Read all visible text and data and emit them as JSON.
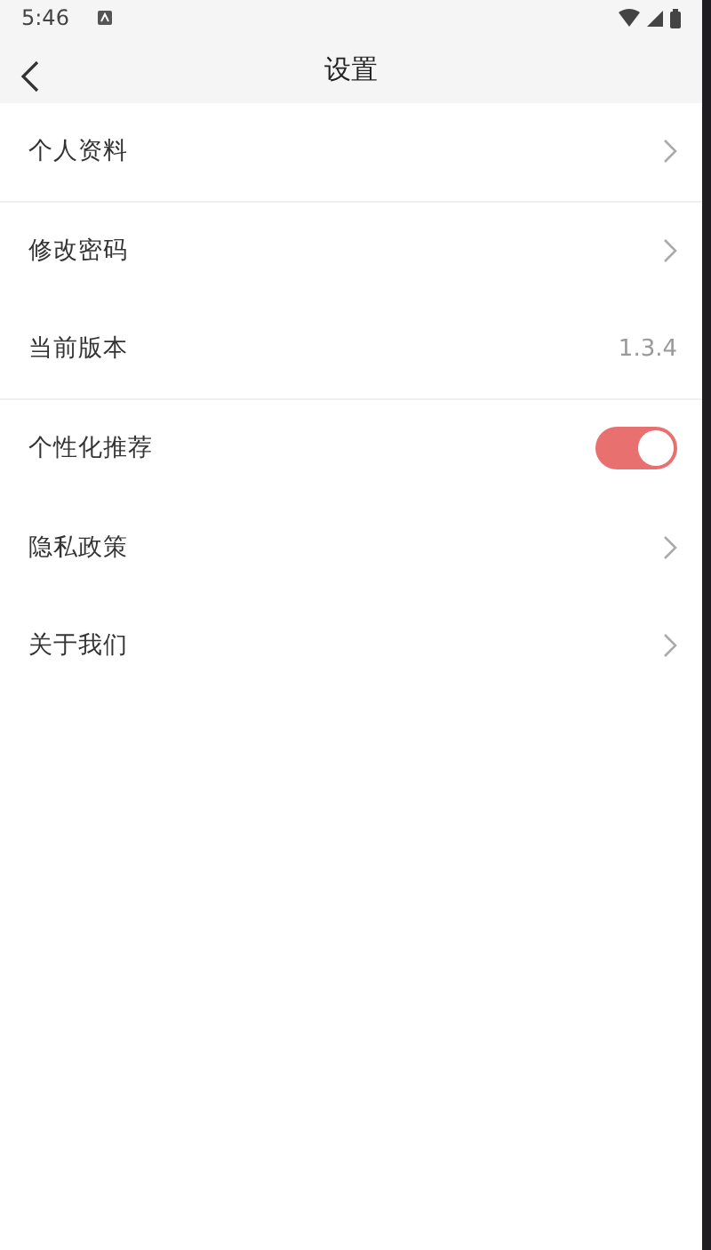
{
  "status_bar": {
    "time": "5:46"
  },
  "header": {
    "title": "设置"
  },
  "items": [
    {
      "kind": "link",
      "label": "个人资料",
      "divider": true
    },
    {
      "kind": "link",
      "label": "修改密码",
      "divider": false
    },
    {
      "kind": "value",
      "label": "当前版本",
      "value": "1.3.4",
      "divider": true
    },
    {
      "kind": "toggle",
      "label": "个性化推荐",
      "on": true,
      "divider": false
    },
    {
      "kind": "link",
      "label": "隐私政策",
      "divider": false
    },
    {
      "kind": "link",
      "label": "关于我们",
      "divider": false
    }
  ]
}
